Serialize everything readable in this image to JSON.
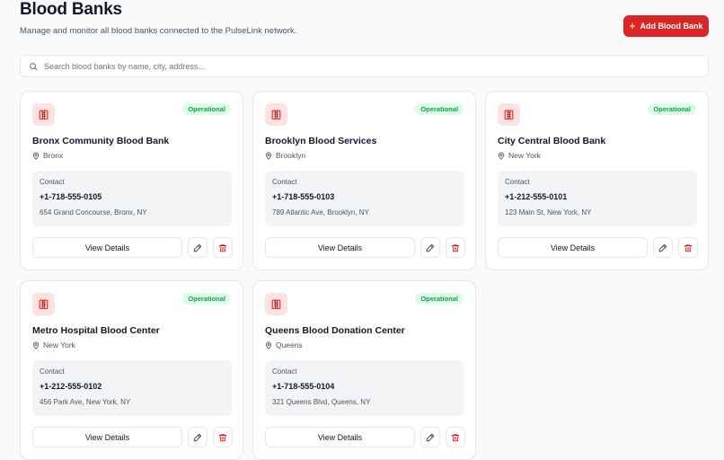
{
  "header": {
    "title": "Blood Banks",
    "subtitle": "Manage and monitor all blood banks connected to the PulseLink network.",
    "add_button_label": "Add Blood Bank",
    "add_button_icon": "plus-icon"
  },
  "search": {
    "placeholder": "Search blood banks by name, city, address...",
    "value": ""
  },
  "colors": {
    "accent": "#dc2626",
    "accent_light": "#fee2e2",
    "status_green": "#16a34a",
    "status_green_bg": "#dcfce7"
  },
  "banks": [
    {
      "name": "Bronx Community Blood Bank",
      "city": "Bronx",
      "status": "Operational",
      "contact_label": "Contact",
      "phone": "+1-718-555-0105",
      "address": "654 Grand Concourse, Bronx, NY",
      "view_label": "View Details"
    },
    {
      "name": "Brooklyn Blood Services",
      "city": "Brooklyn",
      "status": "Operational",
      "contact_label": "Contact",
      "phone": "+1-718-555-0103",
      "address": "789 Atlantic Ave, Brooklyn, NY",
      "view_label": "View Details"
    },
    {
      "name": "City Central Blood Bank",
      "city": "New York",
      "status": "Operational",
      "contact_label": "Contact",
      "phone": "+1-212-555-0101",
      "address": "123 Main St, New York, NY",
      "view_label": "View Details"
    },
    {
      "name": "Metro Hospital Blood Center",
      "city": "New York",
      "status": "Operational",
      "contact_label": "Contact",
      "phone": "+1-212-555-0102",
      "address": "456 Park Ave, New York, NY",
      "view_label": "View Details"
    },
    {
      "name": "Queens Blood Donation Center",
      "city": "Queens",
      "status": "Operational",
      "contact_label": "Contact",
      "phone": "+1-718-555-0104",
      "address": "321 Queens Blvd, Queens, NY",
      "view_label": "View Details"
    }
  ]
}
